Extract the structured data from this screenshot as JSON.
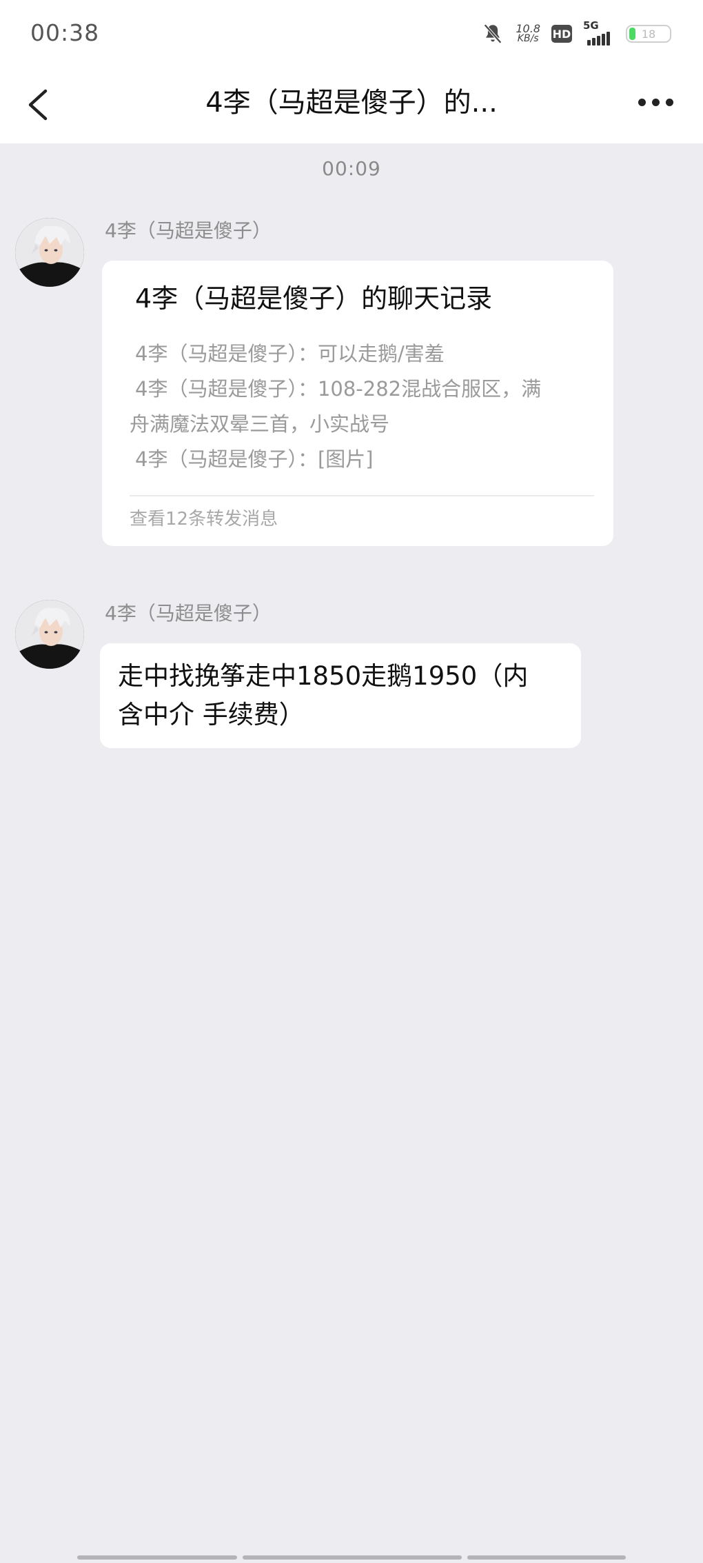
{
  "status_bar": {
    "time": "00:38",
    "net_speed_value": "10.8",
    "net_speed_unit": "KB/s",
    "hd_label": "HD",
    "network_label": "5G",
    "battery_level": "18",
    "icons": [
      "bell-muted-icon",
      "hd-icon",
      "signal-icon",
      "battery-icon"
    ]
  },
  "nav": {
    "title": "4李（马超是傻子）的...",
    "back_icon": "chevron-left-icon",
    "more_icon": "more-dots-icon"
  },
  "chat": {
    "timestamp": "00:09",
    "messages": [
      {
        "sender": "4李（马超是傻子）",
        "type": "forwarded-history",
        "card_title": "4李（马超是傻子）的聊天记录",
        "lines": [
          "4李（马超是傻子）：可以走鹅/害羞",
          "4李（马超是傻子）：108-282混战合服区，满",
          "舟满魔法双晕三首，小实战号",
          "4李（马超是傻子）：[图片]"
        ],
        "footer": "查看12条转发消息"
      },
      {
        "sender": "4李（马超是傻子）",
        "type": "text",
        "text_line1": "走中找挽筝走中1850走鹅1950（内",
        "text_line2": "含中介 手续费）"
      }
    ]
  },
  "colors": {
    "background": "#ededf1",
    "bubble": "#ffffff",
    "battery_fill": "#4cd964"
  }
}
